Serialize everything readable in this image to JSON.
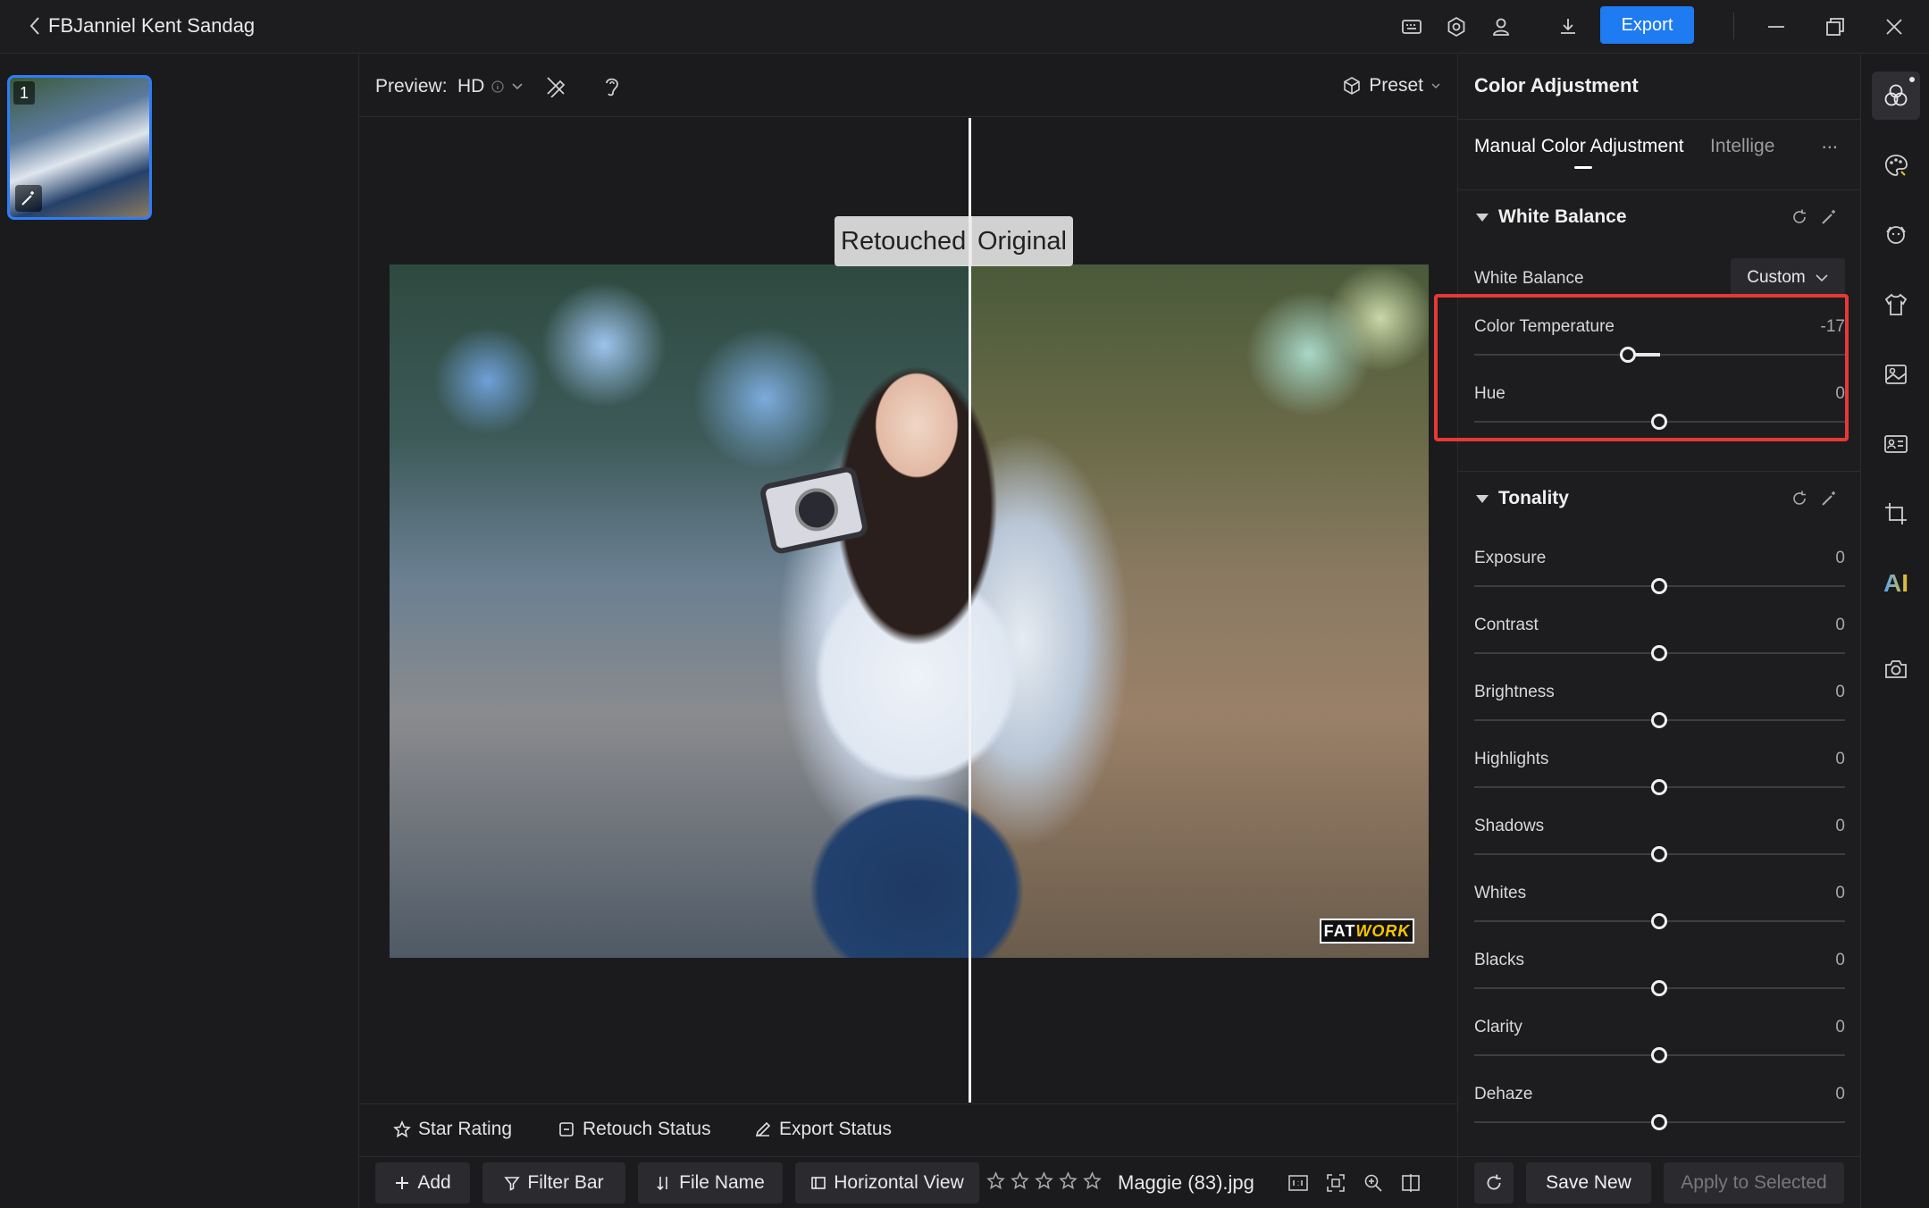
{
  "titlebar": {
    "title": "FBJanniel Kent Sandag",
    "export_label": "Export"
  },
  "thumbnail": {
    "index": "1"
  },
  "toolbar": {
    "preview_label": "Preview:",
    "preview_value": "HD",
    "preset_label": "Preset"
  },
  "compare": {
    "left_label": "Retouched",
    "right_label": "Original",
    "watermark_a": "FAT",
    "watermark_b": "WORK"
  },
  "status_bar": {
    "star_rating": "Star Rating",
    "retouch_status": "Retouch Status",
    "export_status": "Export Status"
  },
  "bottom_bar": {
    "add": "Add",
    "filter_bar": "Filter Bar",
    "file_name": "File Name",
    "horizontal_view": "Horizontal View",
    "rating": 0,
    "filename": "Maggie (83).jpg"
  },
  "right_panel": {
    "title": "Color Adjustment",
    "tab_active": "Manual Color Adjustment",
    "tab_other": "Intellige",
    "more": "...",
    "white_balance": {
      "section": "White Balance",
      "label": "White Balance",
      "mode": "Custom",
      "sliders": [
        {
          "label": "Color Temperature",
          "value": "-17"
        },
        {
          "label": "Hue",
          "value": "0"
        }
      ]
    },
    "tonality": {
      "section": "Tonality",
      "sliders": [
        {
          "label": "Exposure",
          "value": "0"
        },
        {
          "label": "Contrast",
          "value": "0"
        },
        {
          "label": "Brightness",
          "value": "0"
        },
        {
          "label": "Highlights",
          "value": "0"
        },
        {
          "label": "Shadows",
          "value": "0"
        },
        {
          "label": "Whites",
          "value": "0"
        },
        {
          "label": "Blacks",
          "value": "0"
        },
        {
          "label": "Clarity",
          "value": "0"
        },
        {
          "label": "Dehaze",
          "value": "0"
        }
      ]
    },
    "buttons": {
      "save_new": "Save New",
      "apply_selected": "Apply to Selected"
    }
  },
  "colors": {
    "accent": "#1e7bf2",
    "highlight": "#e53935"
  },
  "toolstrip_icons": [
    "color-adjust-icon",
    "palette-icon",
    "face-retouch-icon",
    "clothing-icon",
    "background-icon",
    "id-photo-icon",
    "crop-icon",
    "ai-icon",
    "camera-icon"
  ]
}
